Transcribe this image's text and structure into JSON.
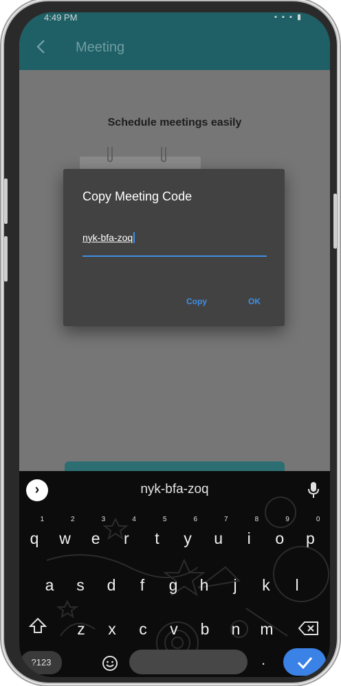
{
  "status": {
    "time": "4:49 PM",
    "icons": "▪ ▪ ▪ ▮"
  },
  "appbar": {
    "title": "Meeting"
  },
  "background": {
    "headline": "Schedule meetings easily"
  },
  "dialog": {
    "title": "Copy Meeting Code",
    "code_value": "nyk-bfa-zoq",
    "copy_label": "Copy",
    "ok_label": "OK"
  },
  "keyboard": {
    "suggestion": "nyk-bfa-zoq",
    "expand_glyph": "›",
    "row1": [
      {
        "k": "q",
        "n": "1"
      },
      {
        "k": "w",
        "n": "2"
      },
      {
        "k": "e",
        "n": "3"
      },
      {
        "k": "r",
        "n": "4"
      },
      {
        "k": "t",
        "n": "5"
      },
      {
        "k": "y",
        "n": "6"
      },
      {
        "k": "u",
        "n": "7"
      },
      {
        "k": "i",
        "n": "8"
      },
      {
        "k": "o",
        "n": "9"
      },
      {
        "k": "p",
        "n": "0"
      }
    ],
    "row2": [
      "a",
      "s",
      "d",
      "f",
      "g",
      "h",
      "j",
      "k",
      "l"
    ],
    "row3": [
      "z",
      "x",
      "c",
      "v",
      "b",
      "n",
      "m"
    ],
    "num_label": "?123",
    "period_label": "."
  },
  "colors": {
    "accent": "#3f8fe6",
    "appbar": "#1f5f66",
    "dialog": "#424242",
    "enter": "#3b82e6"
  }
}
